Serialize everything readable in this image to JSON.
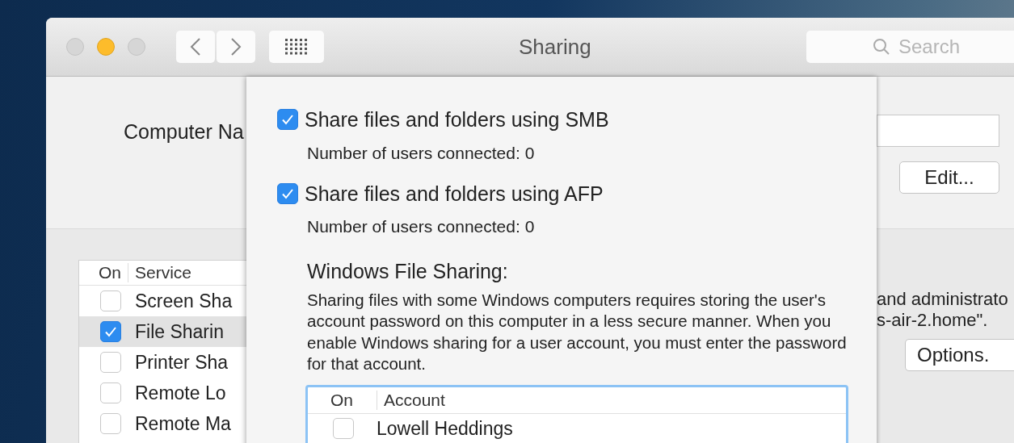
{
  "window": {
    "title": "Sharing",
    "search": {
      "placeholder": "Search"
    }
  },
  "computer_name": {
    "label": "Computer Na",
    "edit_button": "Edit..."
  },
  "services": {
    "columns": [
      "On",
      "Service"
    ],
    "rows": [
      {
        "name": "Screen Sha",
        "checked": false,
        "selected": false
      },
      {
        "name": "File Sharin",
        "checked": true,
        "selected": true
      },
      {
        "name": "Printer Sha",
        "checked": false,
        "selected": false
      },
      {
        "name": "Remote Lo",
        "checked": false,
        "selected": false
      },
      {
        "name": "Remote Ma",
        "checked": false,
        "selected": false
      }
    ]
  },
  "service_info": [
    "and administrato",
    "s-air-2.home\"."
  ],
  "options_button": "Options.",
  "sheet": {
    "options": [
      {
        "label": "Share files and folders using SMB",
        "checked": true,
        "status": "Number of users connected: 0"
      },
      {
        "label": "Share files and folders using AFP",
        "checked": true,
        "status": "Number of users connected: 0"
      }
    ],
    "windows_heading": "Windows File Sharing:",
    "windows_note": "Sharing files with some Windows computers requires storing the user's account password on this computer in a less secure manner.  When you enable Windows sharing for a user account, you must enter the password for that account.",
    "accounts": {
      "columns": [
        "On",
        "Account"
      ],
      "rows": [
        {
          "name": "Lowell Heddings",
          "checked": false
        }
      ]
    }
  }
}
